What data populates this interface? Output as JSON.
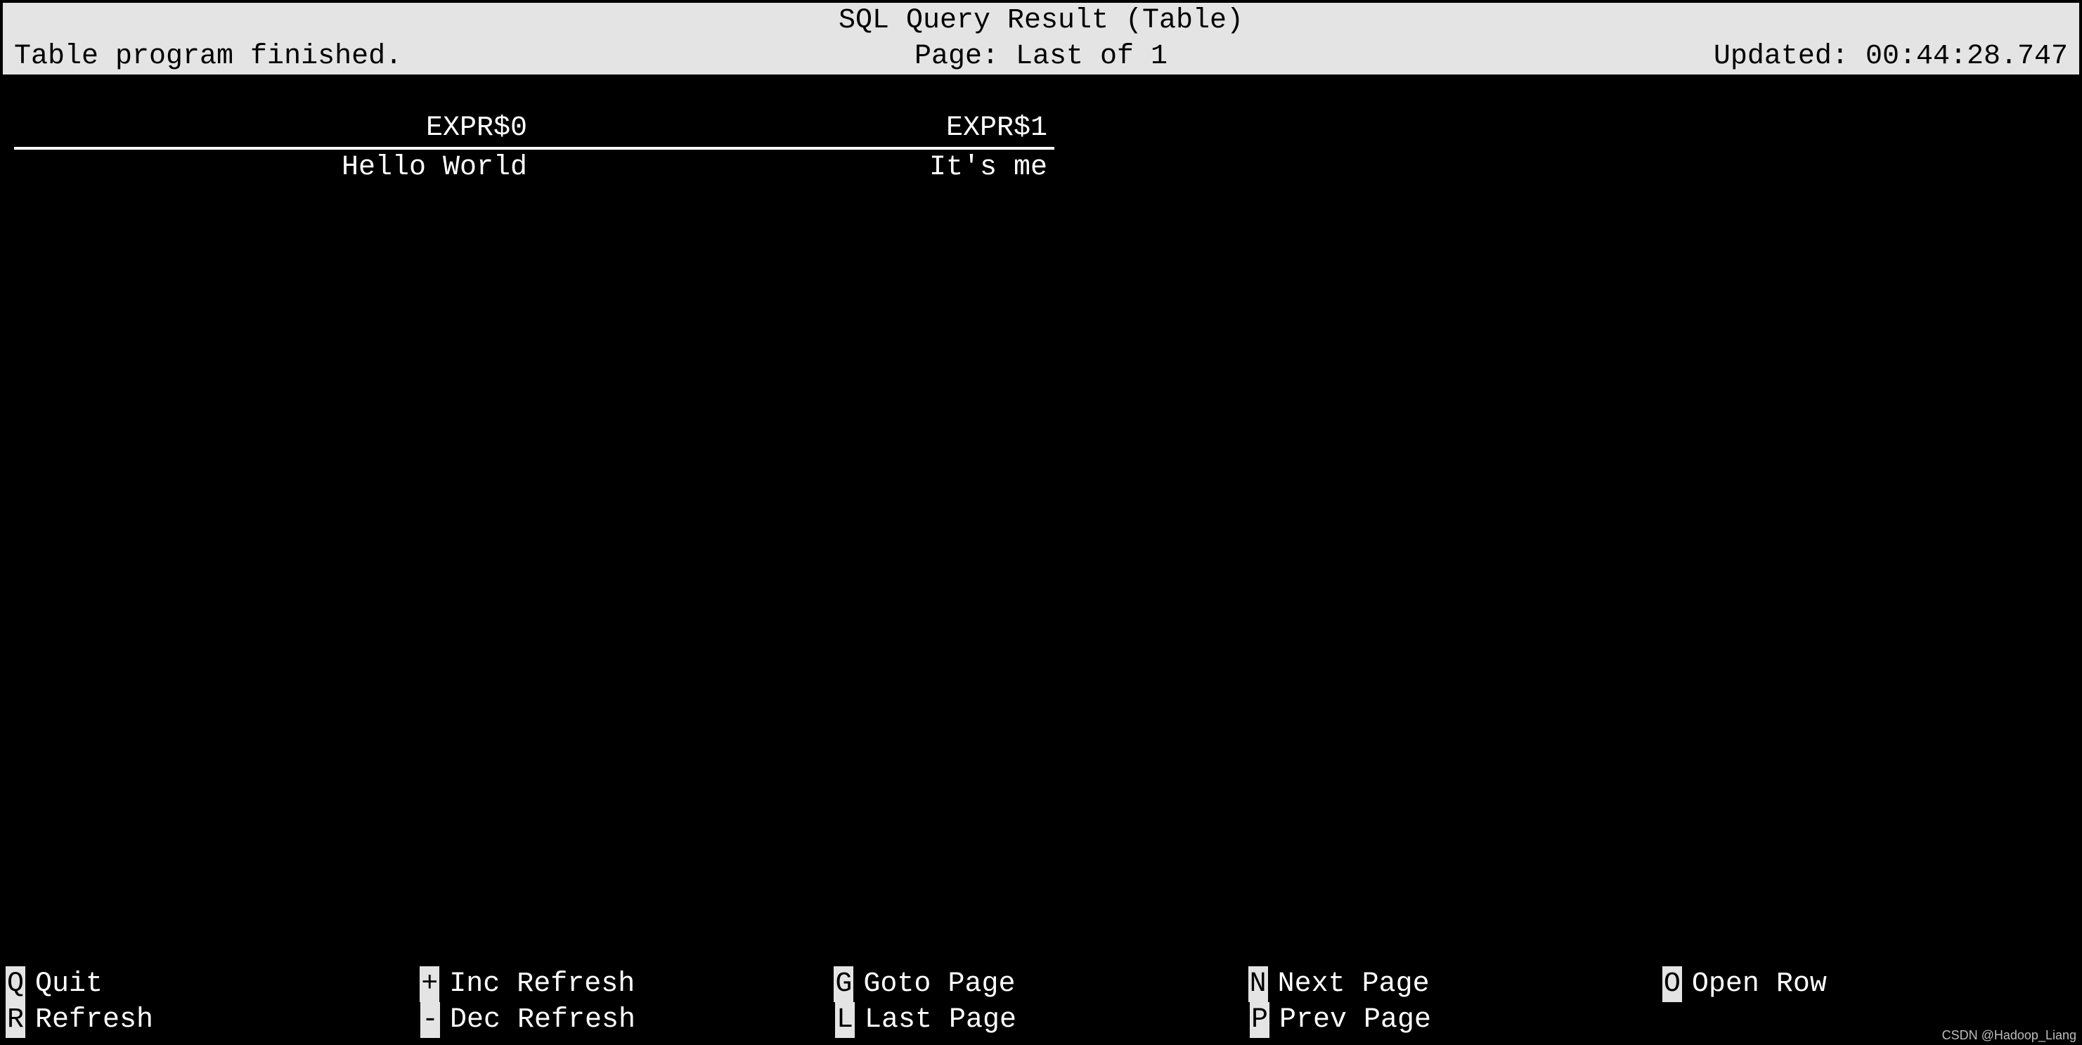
{
  "header": {
    "title": "SQL Query Result (Table)",
    "status_left": "Table program finished.",
    "status_center": "Page: Last of 1",
    "status_right": "Updated: 00:44:28.747"
  },
  "table": {
    "columns": [
      "EXPR$0",
      "EXPR$1"
    ],
    "rows": [
      [
        "Hello World",
        "It's me"
      ]
    ]
  },
  "shortcuts": {
    "row1": [
      {
        "key": "Q",
        "label": "Quit"
      },
      {
        "key": "+",
        "label": "Inc Refresh"
      },
      {
        "key": "G",
        "label": "Goto Page"
      },
      {
        "key": "N",
        "label": "Next Page"
      },
      {
        "key": "O",
        "label": "Open Row"
      }
    ],
    "row2": [
      {
        "key": "R",
        "label": "Refresh"
      },
      {
        "key": "-",
        "label": "Dec Refresh"
      },
      {
        "key": "L",
        "label": "Last Page"
      },
      {
        "key": "P",
        "label": "Prev Page"
      }
    ]
  },
  "watermark": "CSDN @Hadoop_Liang"
}
